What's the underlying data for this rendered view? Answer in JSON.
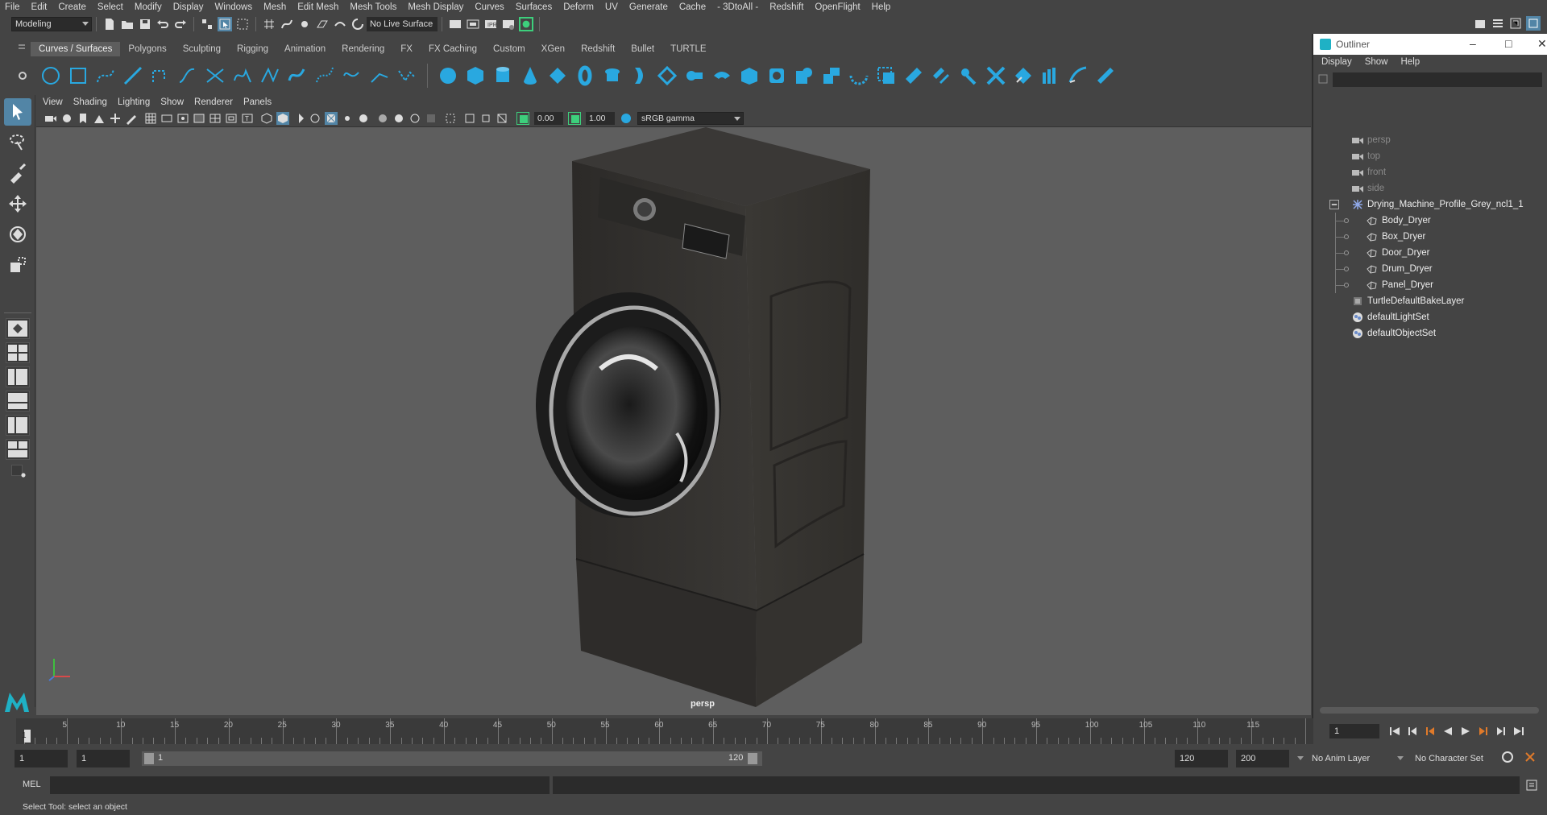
{
  "menubar": [
    "File",
    "Edit",
    "Create",
    "Select",
    "Modify",
    "Display",
    "Windows",
    "Mesh",
    "Edit Mesh",
    "Mesh Tools",
    "Mesh Display",
    "Curves",
    "Surfaces",
    "Deform",
    "UV",
    "Generate",
    "Cache",
    "- 3DtoAll -",
    "Redshift",
    "OpenFlight",
    "Help"
  ],
  "statusline": {
    "mode": "Modeling",
    "live_surface": "No Live Surface"
  },
  "shelf_tabs": [
    "Curves / Surfaces",
    "Polygons",
    "Sculpting",
    "Rigging",
    "Animation",
    "Rendering",
    "FX",
    "FX Caching",
    "Custom",
    "XGen",
    "Redshift",
    "Bullet",
    "TURTLE"
  ],
  "shelf_active_tab": "Curves / Surfaces",
  "viewport": {
    "menus": [
      "View",
      "Shading",
      "Lighting",
      "Show",
      "Renderer",
      "Panels"
    ],
    "exposure": "0.00",
    "gamma": "1.00",
    "color_space": "sRGB gamma",
    "camera_label": "persp"
  },
  "outliner": {
    "title": "Outliner",
    "menus": [
      "Display",
      "Show",
      "Help"
    ],
    "items": [
      {
        "label": "persp",
        "depth": 0,
        "icon": "camera-icon",
        "dim": true
      },
      {
        "label": "top",
        "depth": 0,
        "icon": "camera-icon",
        "dim": true
      },
      {
        "label": "front",
        "depth": 0,
        "icon": "camera-icon",
        "dim": true
      },
      {
        "label": "side",
        "depth": 0,
        "icon": "camera-icon",
        "dim": true
      },
      {
        "label": "Drying_Machine_Profile_Grey_ncl1_1",
        "depth": 0,
        "icon": "group-icon",
        "expander": true
      },
      {
        "label": "Body_Dryer",
        "depth": 1,
        "icon": "mesh-icon"
      },
      {
        "label": "Box_Dryer",
        "depth": 1,
        "icon": "mesh-icon"
      },
      {
        "label": "Door_Dryer",
        "depth": 1,
        "icon": "mesh-icon"
      },
      {
        "label": "Drum_Dryer",
        "depth": 1,
        "icon": "mesh-icon"
      },
      {
        "label": "Panel_Dryer",
        "depth": 1,
        "icon": "mesh-icon"
      },
      {
        "label": "TurtleDefaultBakeLayer",
        "depth": 0,
        "icon": "bake-layer-icon"
      },
      {
        "label": "defaultLightSet",
        "depth": 0,
        "icon": "set-icon"
      },
      {
        "label": "defaultObjectSet",
        "depth": 0,
        "icon": "set-icon"
      }
    ]
  },
  "timeline": {
    "ticks": [
      "5",
      "10",
      "15",
      "20",
      "25",
      "30",
      "35",
      "40",
      "45",
      "50",
      "55",
      "60",
      "65",
      "70",
      "75",
      "80",
      "85",
      "90",
      "95",
      "100",
      "105",
      "110",
      "115"
    ],
    "current_frame_marker": "1",
    "current_frame_field": "1"
  },
  "range": {
    "start": "1",
    "playback_start": "1",
    "slider_start": "1",
    "slider_end": "120",
    "playback_end": "120",
    "end": "200",
    "anim_layer": "No Anim Layer",
    "character_set": "No Character Set"
  },
  "command": {
    "label": "MEL"
  },
  "helpline": "Select Tool: select an object",
  "colors": {
    "accent": "#5285a6",
    "shelf_icon": "#29a8e0",
    "viewport_bg": "#5e5e5e"
  }
}
